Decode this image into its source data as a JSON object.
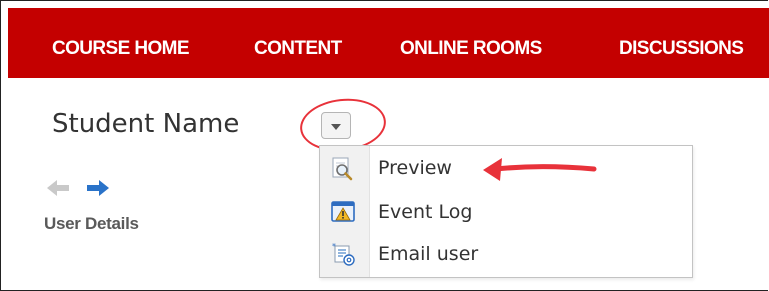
{
  "nav": {
    "items": [
      {
        "label": "COURSE HOME"
      },
      {
        "label": "CONTENT"
      },
      {
        "label": "ONLINE ROOMS"
      },
      {
        "label": "DISCUSSIONS"
      }
    ]
  },
  "header": {
    "title": "Student Name",
    "dropdown_icon": "chevron-down-icon"
  },
  "user_panel": {
    "prev_icon": "arrow-left-icon",
    "next_icon": "arrow-right-icon",
    "link_label": "User Details"
  },
  "menu": {
    "items": [
      {
        "label": "Preview",
        "icon": "preview-magnifier-icon"
      },
      {
        "label": "Event Log",
        "icon": "warning-icon"
      },
      {
        "label": "Email user",
        "icon": "email-user-icon"
      }
    ]
  },
  "annotations": {
    "highlight_color": "#e8323a",
    "accent_color": "#c40000"
  }
}
